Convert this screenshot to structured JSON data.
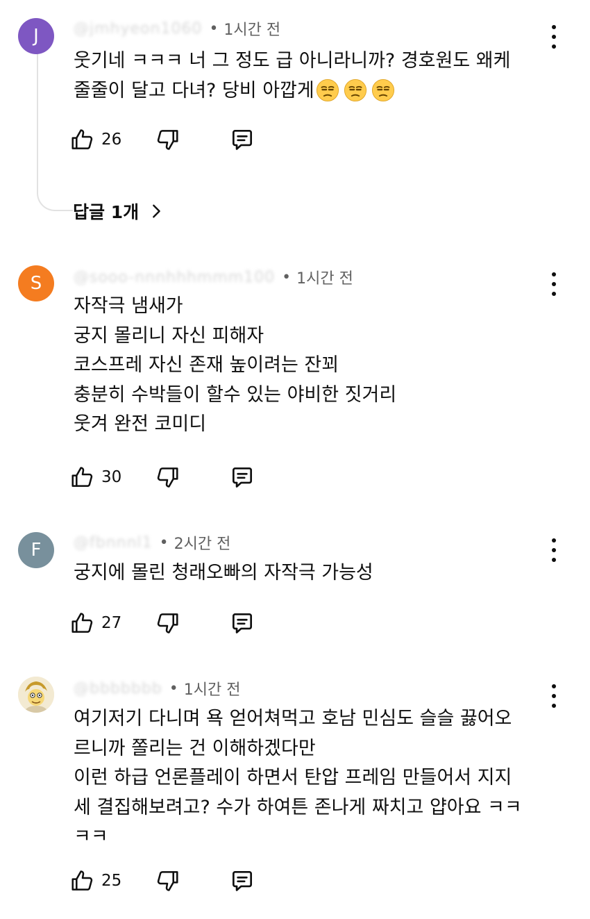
{
  "comments": [
    {
      "avatar_initial": "J",
      "avatar_color": "#7e57c2",
      "author": "@jmhyeon1060",
      "time": "1시간 전",
      "lines": [
        "웃기네 ㅋㅋㅋ 너 그 정도 급 아니라니까? 경호원도 왜케",
        "줄줄이 달고 다녀? 당비 아깝게"
      ],
      "emoji": "unamused-face",
      "likes": "26",
      "reply_count_label": "답글 1개"
    },
    {
      "avatar_initial": "S",
      "avatar_color": "#f47c20",
      "author": "@sooo-nnnhhhmmm100",
      "time": "1시간 전",
      "lines": [
        "자작극 냄새가",
        "궁지 몰리니 자신 피해자",
        "코스프레 자신 존재 높이려는 잔꾀",
        "충분히 수박들이 할수 있는 야비한 짓거리",
        "웃겨 완전 코미디"
      ],
      "likes": "30"
    },
    {
      "avatar_initial": "F",
      "avatar_color": "#78909c",
      "author": "@fbnnnl1",
      "time": "2시간 전",
      "lines": [
        "궁지에 몰린 청래오빠의 자작극 가능성"
      ],
      "likes": "27"
    },
    {
      "avatar_initial": "",
      "avatar_color": "#f3ead2",
      "author": "@bbbbbbb",
      "time": "1시간 전",
      "lines": [
        "여기저기 다니며 욕 얻어쳐먹고 호남 민심도 슬슬 끓어오",
        "르니까 쫄리는 건 이해하겠다만",
        "이런 하급 언론플레이 하면서 탄압 프레임 만들어서 지지",
        "세 결집해보려고? 수가 하여튼 존나게 짜치고 얍아요 ㅋㅋ",
        "ㅋㅋ"
      ],
      "likes": "25"
    }
  ],
  "icons": {
    "like": "thumbs-up-icon",
    "dislike": "thumbs-down-icon",
    "reply": "reply-comment-icon",
    "more": "more-vertical-icon",
    "chevron": "chevron-right-icon"
  }
}
